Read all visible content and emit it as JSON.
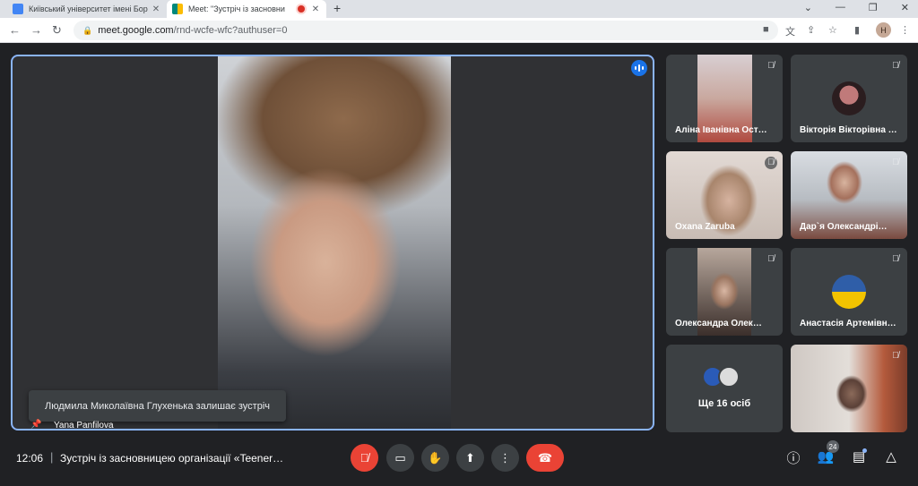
{
  "browser": {
    "tabs": [
      {
        "title": "Київський університет імені Бор",
        "favicon_color": "#4285f4"
      },
      {
        "title": "Meet: \"Зустріч із засновни",
        "favicon_color": "#00897b",
        "recording": true
      }
    ],
    "new_tab": "+",
    "address": {
      "host": "meet.google.com",
      "path": "/rnd-wcfe-wfc?authuser=0"
    },
    "profile_initial": "H"
  },
  "meet": {
    "main": {
      "presenter_name": "Yana Panfilova",
      "toast": "Людмила Миколаївна Глухенька залишає зустріч"
    },
    "participants": [
      {
        "name": "Аліна Іванівна Ост…",
        "type": "video",
        "colors": [
          "#d8cfd2",
          "#b08f8c"
        ]
      },
      {
        "name": "Вікторія Вікторівна …",
        "type": "avatar",
        "colors": [
          "#c07a7a",
          "#2b1d1f"
        ]
      },
      {
        "name": "Oxana Zaruba",
        "type": "video",
        "colors": [
          "#e2d9d4",
          "#a8856c"
        ]
      },
      {
        "name": "Дар`я Олександрі…",
        "type": "video",
        "colors": [
          "#d9dde2",
          "#7a4a3f"
        ]
      },
      {
        "name": "Олександра Олек…",
        "type": "video",
        "colors": [
          "#b7a79c",
          "#3b2f2b"
        ]
      },
      {
        "name": "Анастасія Артемівн…",
        "type": "avatar",
        "colors": [
          "#2f5ea8",
          "#f2c300"
        ]
      },
      {
        "name": "",
        "type": "video",
        "colors": [
          "#cfc8c3",
          "#5a4037"
        ]
      }
    ],
    "more": {
      "label": "Ще 16 осіб",
      "avatar_colors": [
        "#2a5bb8",
        "#dcdcdc"
      ]
    },
    "bottom": {
      "time": "12:06",
      "separator": "|",
      "meeting_title": "Зустріч із засновницею організації «Teener…",
      "people_count": "24"
    }
  },
  "colors": {
    "accent": "#8ab4f8",
    "danger": "#ea4335",
    "background": "#202124",
    "tile": "#3c4043"
  }
}
